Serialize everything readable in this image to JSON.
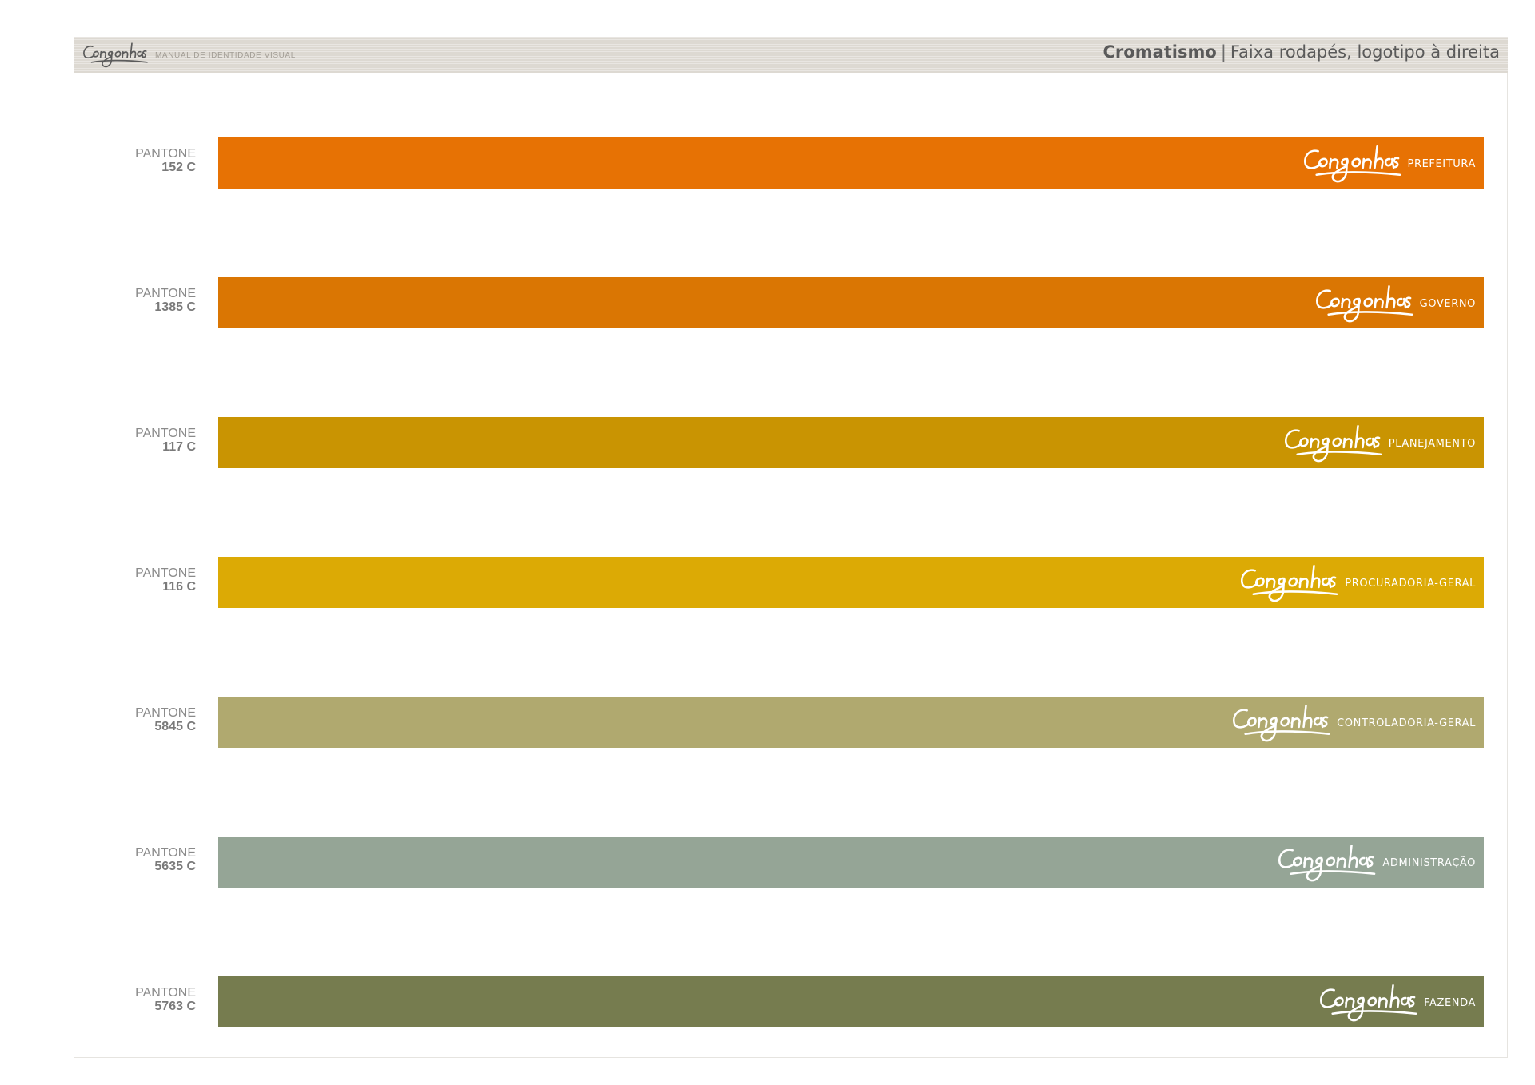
{
  "header": {
    "brand": "Congonhas",
    "manual_label": "MANUAL DE IDENTIDADE VISUAL",
    "title_main": "Cromatismo",
    "title_separator": "|",
    "title_sub": "Faixa rodapés, logotipo à direita"
  },
  "stripes": [
    {
      "pantone_label": "PANTONE",
      "pantone_code": "152 C",
      "department": "PREFEITURA",
      "color": "#e77204"
    },
    {
      "pantone_label": "PANTONE",
      "pantone_code": "1385 C",
      "department": "GOVERNO",
      "color": "#da7603"
    },
    {
      "pantone_label": "PANTONE",
      "pantone_code": "117 C",
      "department": "PLANEJAMENTO",
      "color": "#c99402"
    },
    {
      "pantone_label": "PANTONE",
      "pantone_code": "116 C",
      "department": "PROCURADORIA-GERAL",
      "color": "#dcaa05"
    },
    {
      "pantone_label": "PANTONE",
      "pantone_code": "5845 C",
      "department": "CONTROLADORIA-GERAL",
      "color": "#b0a96f"
    },
    {
      "pantone_label": "PANTONE",
      "pantone_code": "5635 C",
      "department": "ADMINISTRAÇÃO",
      "color": "#95a596"
    },
    {
      "pantone_label": "PANTONE",
      "pantone_code": "5763 C",
      "department": "FAZENDA",
      "color": "#767c4f"
    }
  ]
}
